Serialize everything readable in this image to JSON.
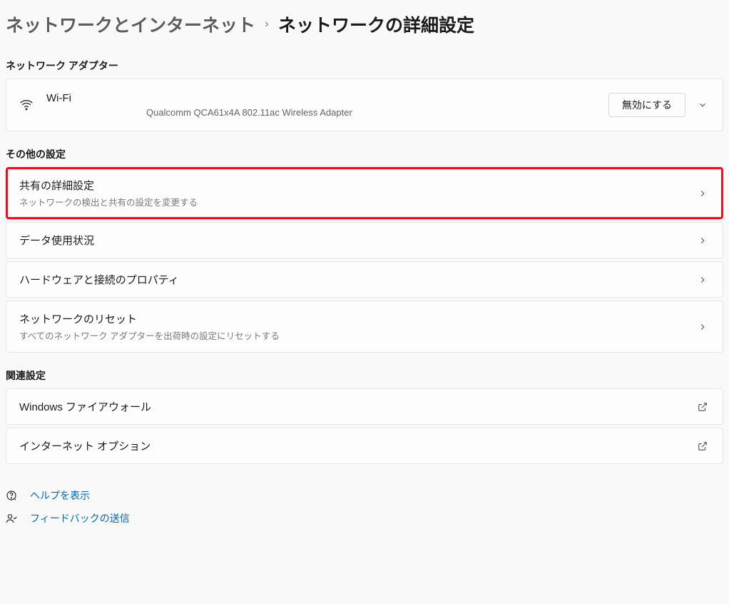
{
  "breadcrumb": {
    "parent": "ネットワークとインターネット",
    "current": "ネットワークの詳細設定"
  },
  "sections": {
    "adapters_title": "ネットワーク アダプター",
    "other_title": "その他の設定",
    "related_title": "関連設定"
  },
  "adapter": {
    "name": "Wi-Fi",
    "device": "Qualcomm QCA61x4A 802.11ac Wireless Adapter",
    "disable_label": "無効にする"
  },
  "other_items": {
    "sharing": {
      "title": "共有の詳細設定",
      "sub": "ネットワークの検出と共有の設定を変更する"
    },
    "data_usage": {
      "title": "データ使用状況"
    },
    "hardware": {
      "title": "ハードウェアと接続のプロパティ"
    },
    "reset": {
      "title": "ネットワークのリセット",
      "sub": "すべてのネットワーク アダプターを出荷時の設定にリセットする"
    }
  },
  "related_items": {
    "firewall": {
      "title": "Windows ファイアウォール"
    },
    "inet_options": {
      "title": "インターネット オプション"
    }
  },
  "footer": {
    "help": "ヘルプを表示",
    "feedback": "フィードバックの送信"
  }
}
